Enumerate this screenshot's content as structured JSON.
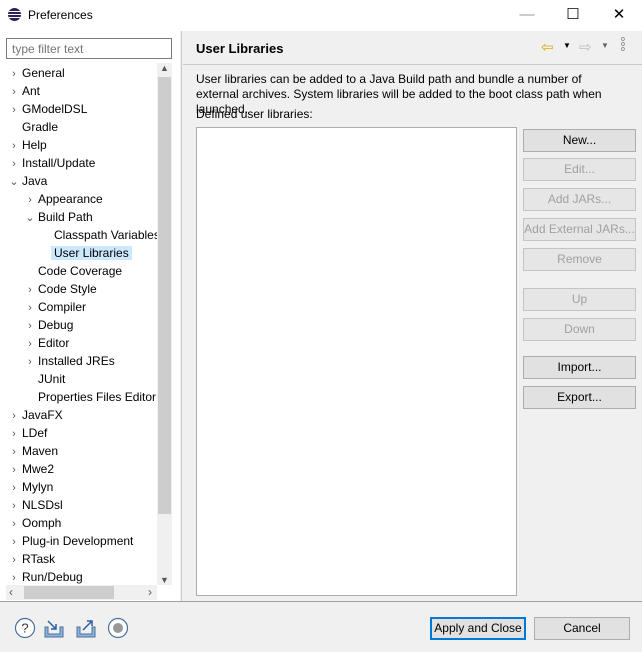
{
  "window": {
    "title": "Preferences",
    "minimize": "—",
    "maximize": "☐",
    "close": "✕"
  },
  "filter": {
    "placeholder": "type filter text"
  },
  "tree": [
    {
      "label": "General",
      "level": 0,
      "chev": "›"
    },
    {
      "label": "Ant",
      "level": 0,
      "chev": "›"
    },
    {
      "label": "GModelDSL",
      "level": 0,
      "chev": "›"
    },
    {
      "label": "Gradle",
      "level": 0,
      "chev": ""
    },
    {
      "label": "Help",
      "level": 0,
      "chev": "›"
    },
    {
      "label": "Install/Update",
      "level": 0,
      "chev": "›"
    },
    {
      "label": "Java",
      "level": 0,
      "chev": "⌄"
    },
    {
      "label": "Appearance",
      "level": 1,
      "chev": "›"
    },
    {
      "label": "Build Path",
      "level": 1,
      "chev": "⌄"
    },
    {
      "label": "Classpath Variables",
      "level": 2,
      "chev": ""
    },
    {
      "label": "User Libraries",
      "level": 2,
      "chev": "",
      "selected": true
    },
    {
      "label": "Code Coverage",
      "level": 1,
      "chev": ""
    },
    {
      "label": "Code Style",
      "level": 1,
      "chev": "›"
    },
    {
      "label": "Compiler",
      "level": 1,
      "chev": "›"
    },
    {
      "label": "Debug",
      "level": 1,
      "chev": "›"
    },
    {
      "label": "Editor",
      "level": 1,
      "chev": "›"
    },
    {
      "label": "Installed JREs",
      "level": 1,
      "chev": "›"
    },
    {
      "label": "JUnit",
      "level": 1,
      "chev": ""
    },
    {
      "label": "Properties Files Editor",
      "level": 1,
      "chev": ""
    },
    {
      "label": "JavaFX",
      "level": 0,
      "chev": "›"
    },
    {
      "label": "LDef",
      "level": 0,
      "chev": "›"
    },
    {
      "label": "Maven",
      "level": 0,
      "chev": "›"
    },
    {
      "label": "Mwe2",
      "level": 0,
      "chev": "›"
    },
    {
      "label": "Mylyn",
      "level": 0,
      "chev": "›"
    },
    {
      "label": "NLSDsl",
      "level": 0,
      "chev": "›"
    },
    {
      "label": "Oomph",
      "level": 0,
      "chev": "›"
    },
    {
      "label": "Plug-in Development",
      "level": 0,
      "chev": "›"
    },
    {
      "label": "RTask",
      "level": 0,
      "chev": "›"
    },
    {
      "label": "Run/Debug",
      "level": 0,
      "chev": "›"
    }
  ],
  "page": {
    "title": "User Libraries",
    "description": "User libraries can be added to a Java Build path and bundle a number of external archives. System libraries will be added to the boot class path when launched.",
    "defined_label": "Defined user libraries:"
  },
  "buttons": [
    {
      "label": "New...",
      "enabled": true
    },
    {
      "label": "Edit...",
      "enabled": false
    },
    {
      "label": "Add JARs...",
      "enabled": false
    },
    {
      "label": "Add External JARs...",
      "enabled": false
    },
    {
      "label": "Remove",
      "enabled": false
    },
    {
      "label": "Up",
      "enabled": false
    },
    {
      "label": "Down",
      "enabled": false
    },
    {
      "label": "Import...",
      "enabled": true
    },
    {
      "label": "Export...",
      "enabled": true
    }
  ],
  "footer": {
    "apply": "Apply and Close",
    "cancel": "Cancel"
  }
}
